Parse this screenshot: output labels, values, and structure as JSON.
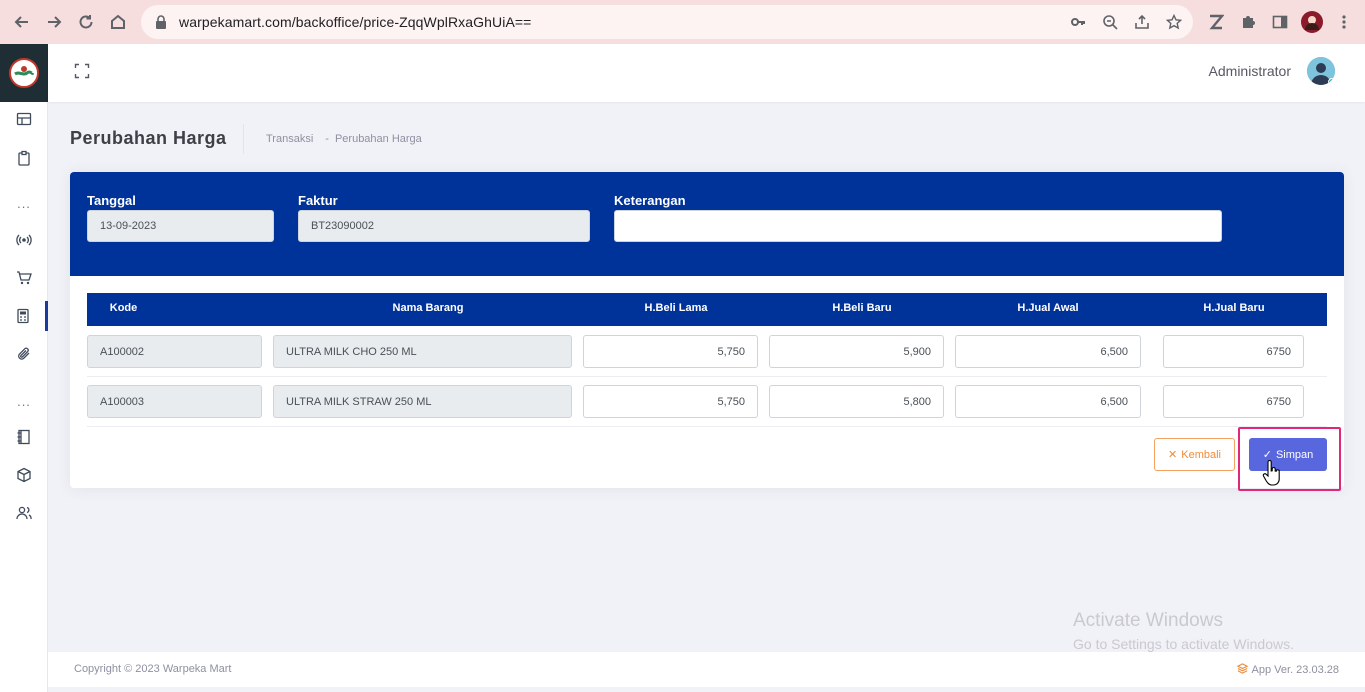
{
  "browser": {
    "url": "warpekamart.com/backoffice/price-ZqqWplRxaGhUiA=="
  },
  "header": {
    "user_name": "Administrator"
  },
  "page": {
    "title": "Perubahan Harga",
    "breadcrumb": [
      "Transaksi",
      "-",
      "Perubahan Harga"
    ]
  },
  "form": {
    "tanggal_label": "Tanggal",
    "tanggal_value": "13-09-2023",
    "faktur_label": "Faktur",
    "faktur_value": "BT23090002",
    "keterangan_label": "Keterangan",
    "keterangan_value": ""
  },
  "table": {
    "columns": [
      "Kode",
      "Nama Barang",
      "H.Beli Lama",
      "H.Beli Baru",
      "H.Jual Awal",
      "H.Jual Baru"
    ],
    "rows": [
      {
        "kode": "A100002",
        "nama": "ULTRA MILK CHO 250 ML",
        "beli_lama": "5,750",
        "beli_baru": "5,900",
        "jual_awal": "6,500",
        "jual_baru": "6750"
      },
      {
        "kode": "A100003",
        "nama": "ULTRA MILK STRAW 250 ML",
        "beli_lama": "5,750",
        "beli_baru": "5,800",
        "jual_awal": "6,500",
        "jual_baru": "6750"
      }
    ]
  },
  "actions": {
    "kembali_label": "Kembali",
    "simpan_label": "Simpan"
  },
  "watermark": {
    "line1": "Activate Windows",
    "line2": "Go to Settings to activate Windows."
  },
  "footer": {
    "copyright": "Copyright © 2023 Warpeka Mart",
    "version": "App Ver. 23.03.28"
  },
  "colors": {
    "primary": "#003399",
    "simpan": "#5867dd",
    "kembali": "#f08c3a",
    "highlight": "#e0287a"
  }
}
